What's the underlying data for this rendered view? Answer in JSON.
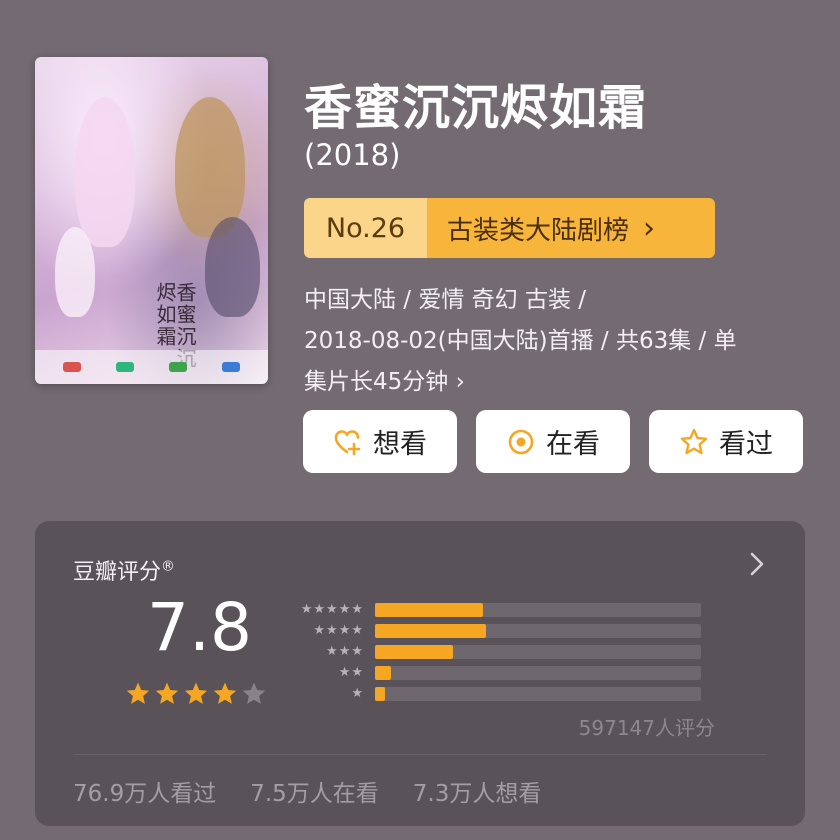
{
  "movie": {
    "title": "香蜜沉沉烬如霜",
    "year": "(2018)",
    "poster_title": "香蜜沉沉烬如霜"
  },
  "rank": {
    "number": "No.26",
    "list_name": "古装类大陆剧榜",
    "chevron": "›"
  },
  "meta": {
    "line1": "中国大陆 / 爱情 奇幻 古装 /",
    "line2": "2018-08-02(中国大陆)首播 / 共63集 / 单",
    "line3": "集片长45分钟 ›"
  },
  "actions": [
    {
      "label": "想看",
      "icon": "heart-plus-icon"
    },
    {
      "label": "在看",
      "icon": "circle-dot-icon"
    },
    {
      "label": "看过",
      "icon": "star-outline-icon"
    }
  ],
  "rating": {
    "header": "豆瓣评分",
    "registered_mark": "®",
    "score": "7.8",
    "stars_filled": 4,
    "stars_total": 5,
    "distribution": [
      {
        "stars": 5,
        "fraction": 0.33
      },
      {
        "stars": 4,
        "fraction": 0.34
      },
      {
        "stars": 3,
        "fraction": 0.24
      },
      {
        "stars": 2,
        "fraction": 0.05
      },
      {
        "stars": 1,
        "fraction": 0.03
      }
    ],
    "count": "597147人评分"
  },
  "stats": {
    "watched": "76.9万人看过",
    "watching": "7.5万人在看",
    "want": "7.3万人想看"
  },
  "colors": {
    "background": "#736a72",
    "accent": "#f5a623",
    "rank_light": "#fbd58a",
    "card": "#5a5259"
  }
}
